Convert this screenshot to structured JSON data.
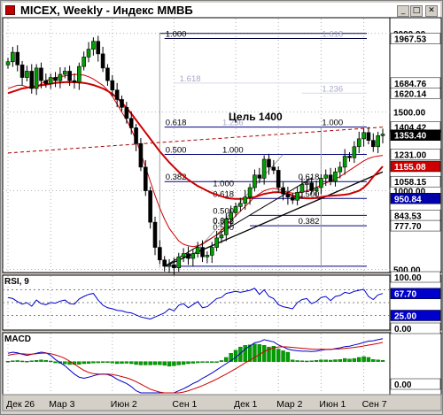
{
  "window": {
    "title": "MICEX, Weekly - Индекс ММВБ",
    "buttons": {
      "minimize": "_",
      "maximize": "□",
      "close": "✕"
    },
    "colors": {
      "background": "#d4d0c8",
      "plot": "#ffffff"
    }
  },
  "chart_data": [
    {
      "panel": "price",
      "type": "candlestick",
      "ylim": [
        480,
        2100
      ],
      "y_scale": "linear",
      "y_ticks": [
        500.0,
        1000.0,
        1500.0,
        2000.0
      ],
      "x_tick_labels": [
        "Дек 26",
        "Мар 3",
        "Июн 2",
        "Сен 1",
        "Дек 1",
        "Мар 2",
        "Июн 1",
        "Сен 7"
      ],
      "price_tags": [
        {
          "value": 1967.53,
          "color": "#ffffff",
          "text_color": "#000000"
        },
        {
          "value": 1684.76,
          "color": "#ffffff",
          "text_color": "#000000"
        },
        {
          "value": 1620.14,
          "color": "#ffffff",
          "text_color": "#000000"
        },
        {
          "value": 1404.42,
          "color": "#ffffff",
          "text_color": "#000000"
        },
        {
          "value": 1353.4,
          "color": "#000000",
          "text_color": "#ffffff"
        },
        {
          "value": 1231.0,
          "color": "#ffffff",
          "text_color": "#000000"
        },
        {
          "value": 1155.08,
          "color": "#cc0000",
          "text_color": "#ffffff"
        },
        {
          "value": 1058.15,
          "color": "#ffffff",
          "text_color": "#000000"
        },
        {
          "value": 950.84,
          "color": "#0000aa",
          "text_color": "#ffffff"
        },
        {
          "value": 843.53,
          "color": "#ffffff",
          "text_color": "#000000"
        },
        {
          "value": 777.7,
          "color": "#ffffff",
          "text_color": "#000000"
        }
      ],
      "annotation": "Цель 1400",
      "fib_labels": [
        "1.000",
        "0.618",
        "0.500",
        "0.382",
        "1.618",
        "1.236",
        "0.618",
        "0.500",
        "0.382",
        "1.000",
        "1.618",
        "1.236",
        "1.000",
        "0.618",
        "0.500",
        "0.382",
        "1.000",
        "0.618",
        "0.500"
      ],
      "weeks": 80,
      "close": [
        1820,
        1880,
        1800,
        1720,
        1760,
        1650,
        1780,
        1700,
        1680,
        1720,
        1700,
        1740,
        1760,
        1700,
        1690,
        1790,
        1850,
        1900,
        1950,
        1870,
        1780,
        1700,
        1640,
        1580,
        1530,
        1460,
        1400,
        1300,
        1150,
        1000,
        800,
        640,
        560,
        520,
        530,
        510,
        580,
        600,
        570,
        600,
        640,
        580,
        590,
        640,
        700,
        720,
        820,
        860,
        900,
        920,
        960,
        1020,
        1100,
        1080,
        1200,
        1150,
        1130,
        1020,
        980,
        960,
        940,
        990,
        1040,
        1050,
        1000,
        1020,
        1080,
        1100,
        1060,
        1120,
        1150,
        1220,
        1210,
        1280,
        1330,
        1370,
        1320,
        1280,
        1350,
        1360
      ],
      "moving_averages": [
        {
          "name": "ma-red-thick",
          "color": "#cc0000",
          "values": [
            1620,
            1630,
            1640,
            1650,
            1655,
            1660,
            1665,
            1670,
            1675,
            1680,
            1685,
            1688,
            1690,
            1691,
            1690,
            1688,
            1685,
            1680,
            1672,
            1662,
            1650,
            1635,
            1615,
            1590,
            1560,
            1525,
            1490,
            1450,
            1410,
            1370,
            1330,
            1290,
            1250,
            1215,
            1180,
            1150,
            1120,
            1095,
            1070,
            1050,
            1030,
            1015,
            1000,
            985,
            975,
            965,
            955,
            950,
            948,
            948,
            950,
            955,
            960,
            970,
            980,
            985,
            990,
            990,
            988,
            980,
            970,
            960,
            955,
            952,
            952,
            955,
            960,
            965,
            968,
            970,
            972,
            975,
            980,
            990,
            1000,
            1020,
            1050,
            1090,
            1120,
            1155
          ]
        },
        {
          "name": "ma-red-thin",
          "color": "#cc0000",
          "values": [
            1650,
            1660,
            1670,
            1670,
            1660,
            1650,
            1660,
            1680,
            1700,
            1710,
            1720,
            1725,
            1730,
            1735,
            1740,
            1738,
            1735,
            1725,
            1710,
            1690,
            1670,
            1640,
            1600,
            1550,
            1500,
            1450,
            1390,
            1320,
            1240,
            1150,
            1060,
            970,
            890,
            820,
            760,
            720,
            680,
            660,
            650,
            645,
            650,
            660,
            680,
            700,
            720,
            750,
            780,
            810,
            840,
            870,
            900,
            930,
            960,
            980,
            1000,
            1010,
            1015,
            1010,
            1000,
            990,
            985,
            985,
            990,
            1000,
            1010,
            1020,
            1035,
            1050,
            1060,
            1075,
            1090,
            1110,
            1130,
            1150,
            1170,
            1190,
            1205,
            1215,
            1220,
            1225
          ]
        },
        {
          "name": "trend-dashed",
          "color": "#aa0000",
          "style": "dashed",
          "from": [
            30,
            1150
          ],
          "to": [
            79,
            1404.42
          ]
        }
      ]
    },
    {
      "panel": "rsi",
      "label": "RSI, 9",
      "ylim": [
        0,
        100
      ],
      "levels": [
        100.0,
        25.0,
        0.0
      ],
      "tags": [
        {
          "value": 100.0,
          "color": "#ffffff",
          "text_color": "#000000"
        },
        {
          "value": 67.7,
          "color": "#0000cc",
          "text_color": "#ffffff"
        },
        {
          "value": 25.0,
          "color": "#0000cc",
          "text_color": "#ffffff"
        },
        {
          "value": 0.0,
          "color": "#ffffff",
          "text_color": "#000000"
        }
      ],
      "values": [
        60,
        58,
        52,
        47,
        50,
        43,
        55,
        48,
        46,
        50,
        49,
        53,
        55,
        48,
        47,
        57,
        62,
        66,
        68,
        55,
        45,
        40,
        38,
        35,
        34,
        31,
        30,
        26,
        22,
        20,
        18,
        22,
        26,
        30,
        38,
        34,
        45,
        48,
        40,
        46,
        52,
        40,
        42,
        50,
        58,
        60,
        68,
        70,
        72,
        70,
        72,
        74,
        78,
        66,
        75,
        62,
        58,
        46,
        42,
        40,
        38,
        50,
        56,
        58,
        48,
        52,
        60,
        62,
        54,
        62,
        64,
        70,
        68,
        72,
        74,
        76,
        62,
        56,
        65,
        67.7
      ]
    },
    {
      "panel": "macd",
      "label": "MACD",
      "ylim": [
        -150,
        130
      ],
      "tags": [
        {
          "value": 0.0,
          "color": "#ffffff",
          "text_color": "#000000"
        }
      ],
      "histogram": [
        2,
        4,
        5,
        3,
        2,
        4,
        6,
        8,
        6,
        3,
        -6,
        -8,
        -11,
        -14,
        -14,
        -13,
        -10,
        -9,
        -7,
        -6,
        -5,
        -5,
        -7,
        -10,
        -9,
        -8,
        -10,
        -14,
        -16,
        -16,
        -16,
        -15,
        -15,
        -18,
        -22,
        -20,
        -16,
        -14,
        -10,
        -8,
        -6,
        -4,
        -2,
        0,
        -2,
        5,
        20,
        40,
        55,
        70,
        78,
        80,
        84,
        82,
        78,
        70,
        74,
        60,
        52,
        45,
        8,
        5,
        4,
        3,
        4,
        6,
        8,
        8,
        7,
        9,
        10,
        15,
        12,
        15,
        20,
        24,
        20,
        10,
        8,
        6
      ],
      "macd_line": [
        40,
        45,
        42,
        35,
        30,
        35,
        40,
        45,
        42,
        30,
        10,
        -5,
        -20,
        -40,
        -60,
        -75,
        -80,
        -75,
        -68,
        -62,
        -60,
        -62,
        -70,
        -85,
        -95,
        -105,
        -120,
        -140,
        -160,
        -170,
        -175,
        -172,
        -168,
        -165,
        -160,
        -150,
        -140,
        -130,
        -118,
        -105,
        -95,
        -80,
        -68,
        -55,
        -40,
        -25,
        -10,
        5,
        20,
        40,
        60,
        75,
        90,
        95,
        105,
        100,
        95,
        80,
        70,
        60,
        55,
        52,
        50,
        50,
        48,
        50,
        55,
        58,
        58,
        62,
        66,
        72,
        74,
        80,
        85,
        92,
        98,
        100,
        105,
        110
      ],
      "signal_line": [
        30,
        35,
        38,
        38,
        36,
        36,
        38,
        40,
        41,
        38,
        32,
        25,
        15,
        2,
        -12,
        -28,
        -42,
        -52,
        -58,
        -60,
        -60,
        -60,
        -62,
        -66,
        -72,
        -78,
        -86,
        -96,
        -108,
        -120,
        -132,
        -140,
        -146,
        -150,
        -152,
        -152,
        -150,
        -146,
        -140,
        -132,
        -124,
        -115,
        -105,
        -95,
        -84,
        -72,
        -60,
        -47,
        -34,
        -20,
        -6,
        7,
        20,
        34,
        48,
        58,
        66,
        70,
        71,
        70,
        68,
        66,
        64,
        62,
        60,
        59,
        59,
        59,
        59,
        60,
        61,
        63,
        65,
        68,
        71,
        75,
        79,
        83,
        87,
        92
      ]
    }
  ]
}
